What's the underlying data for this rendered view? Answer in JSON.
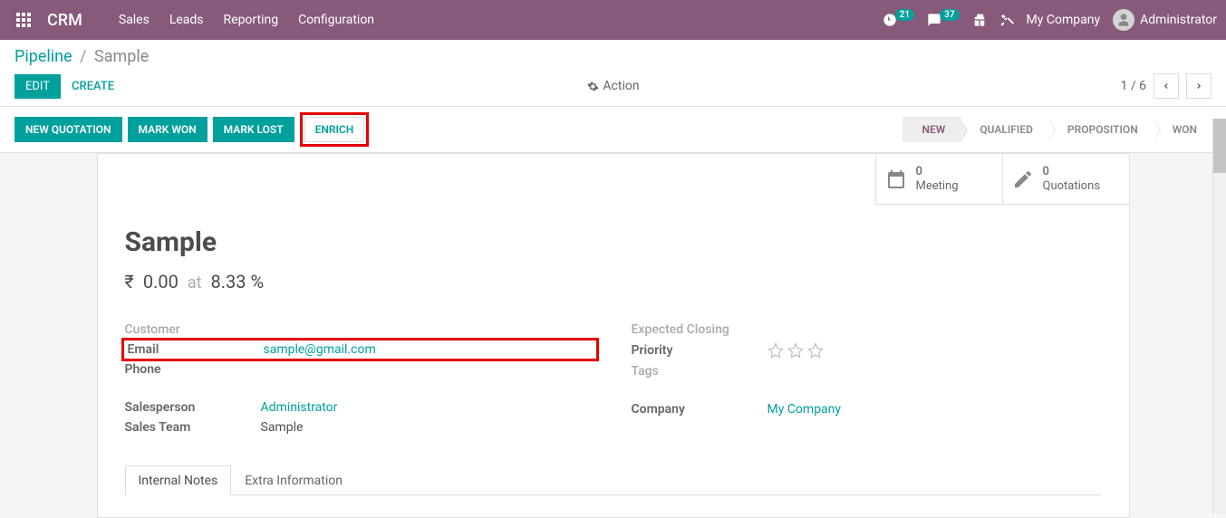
{
  "header": {
    "brand": "CRM",
    "nav": [
      "Sales",
      "Leads",
      "Reporting",
      "Configuration"
    ],
    "badge_clock": "21",
    "badge_chat": "37",
    "company": "My Company",
    "user": "Administrator"
  },
  "breadcrumb": {
    "root": "Pipeline",
    "current": "Sample"
  },
  "buttons": {
    "edit": "EDIT",
    "create": "CREATE",
    "action": "Action",
    "pager": "1 / 6"
  },
  "action_buttons": {
    "new_quotation": "NEW QUOTATION",
    "mark_won": "MARK WON",
    "mark_lost": "MARK LOST",
    "enrich": "ENRICH"
  },
  "stages": [
    "NEW",
    "QUALIFIED",
    "PROPOSITION",
    "WON"
  ],
  "statboxes": {
    "meeting": {
      "count": "0",
      "label": "Meeting"
    },
    "quotations": {
      "count": "0",
      "label": "Quotations"
    }
  },
  "record": {
    "title": "Sample",
    "currency": "₹",
    "amount": "0.00",
    "at": "at",
    "percent": "8.33 %"
  },
  "fields_left": {
    "customer_label": "Customer",
    "email_label": "Email",
    "email_value": "sample@gmail.com",
    "phone_label": "Phone",
    "salesperson_label": "Salesperson",
    "salesperson_value": "Administrator",
    "salesteam_label": "Sales Team",
    "salesteam_value": "Sample"
  },
  "fields_right": {
    "expected_closing_label": "Expected Closing",
    "priority_label": "Priority",
    "tags_label": "Tags",
    "company_label": "Company",
    "company_value": "My Company"
  },
  "tabs": {
    "internal_notes": "Internal Notes",
    "extra_info": "Extra Information"
  }
}
